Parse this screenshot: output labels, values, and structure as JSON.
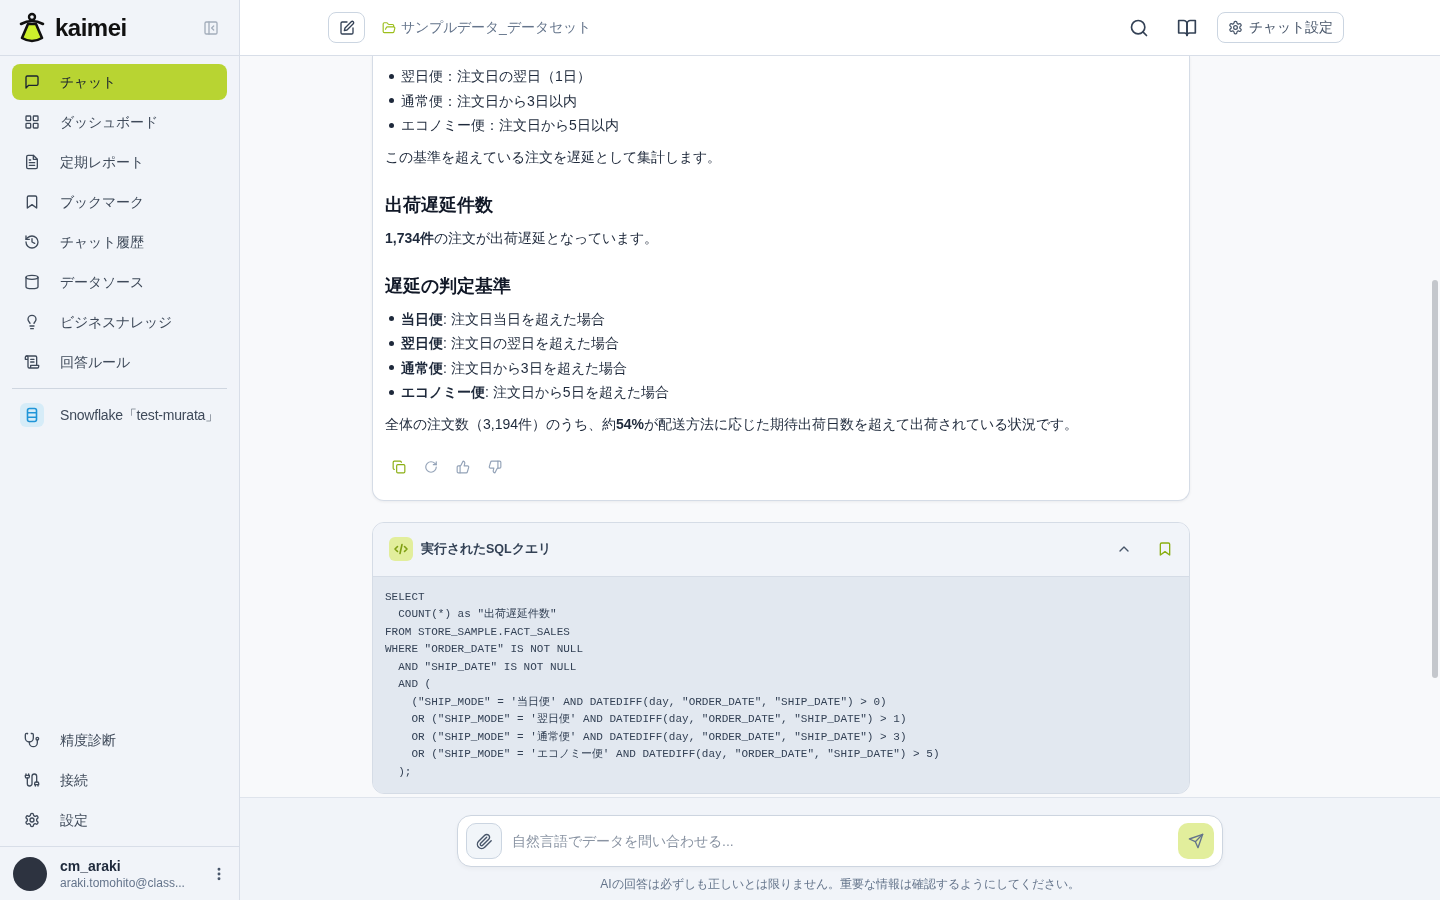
{
  "sidebar": {
    "brand": "kaimei",
    "nav_items": [
      {
        "label": "チャット",
        "selected": true
      },
      {
        "label": "ダッシュボード",
        "selected": false
      },
      {
        "label": "定期レポート",
        "selected": false
      },
      {
        "label": "ブックマーク",
        "selected": false
      },
      {
        "label": "チャット履歴",
        "selected": false
      },
      {
        "label": "データソース",
        "selected": false
      },
      {
        "label": "ビジネスナレッジ",
        "selected": false
      },
      {
        "label": "回答ルール",
        "selected": false
      }
    ],
    "datasource": "Snowflake「test-murata」",
    "footer_items": [
      {
        "label": "精度診断",
        "selected": false
      },
      {
        "label": "接続",
        "selected": false
      },
      {
        "label": "設定",
        "selected": false
      }
    ],
    "user": {
      "name": "cm_araki",
      "email": "araki.tomohito@class..."
    }
  },
  "header": {
    "dataset": "サンプルデータ_データセット",
    "settings_button": "チャット設定"
  },
  "answer": {
    "blocks": [
      {
        "kind": "list",
        "items": [
          "翌日便：注文日の翌日（1日）",
          "通常便：注文日から3日以内",
          "エコノミー便：注文日から5日以内"
        ]
      },
      {
        "kind": "paragraph",
        "text": "この基準を超えている注文を遅延として集計します。"
      },
      {
        "kind": "heading",
        "text": "出荷遅延件数"
      },
      {
        "kind": "paragraph",
        "text": "**1,734件**の注文が出荷遅延となっています。"
      },
      {
        "kind": "heading",
        "text": "遅延の判定基準"
      },
      {
        "kind": "list",
        "items": [
          "**当日便**: 注文日当日を超えた場合",
          "**翌日便**: 注文日の翌日を超えた場合",
          "**通常便**: 注文日から3日を超えた場合",
          "**エコノミー便**: 注文日から5日を超えた場合"
        ]
      },
      {
        "kind": "paragraph",
        "text": "全体の注文数（3,194件）のうち、約**54%**が配送方法に応じた期待出荷日数を超えて出荷されている状況です。"
      }
    ]
  },
  "sql_panel": {
    "title": "実行されたSQLクエリ",
    "expanded": true,
    "code": [
      "SELECT",
      "  COUNT(*) as \"出荷遅延件数\"",
      "FROM STORE_SAMPLE.FACT_SALES",
      "WHERE \"ORDER_DATE\" IS NOT NULL",
      "  AND \"SHIP_DATE\" IS NOT NULL",
      "  AND (",
      "    (\"SHIP_MODE\" = '当日便' AND DATEDIFF(day, \"ORDER_DATE\", \"SHIP_DATE\") > 0)",
      "    OR (\"SHIP_MODE\" = '翌日便' AND DATEDIFF(day, \"ORDER_DATE\", \"SHIP_DATE\") > 1)",
      "    OR (\"SHIP_MODE\" = '通常便' AND DATEDIFF(day, \"ORDER_DATE\", \"SHIP_DATE\") > 3)",
      "    OR (\"SHIP_MODE\" = 'エコノミー便' AND DATEDIFF(day, \"ORDER_DATE\", \"SHIP_DATE\") > 5)",
      "  );"
    ]
  },
  "composer": {
    "placeholder": "自然言語でデータを問い合わせる...",
    "disclaimer": "AIの回答は必ずしも正しいとは限りません。重要な情報は確認するようにしてください。"
  }
}
